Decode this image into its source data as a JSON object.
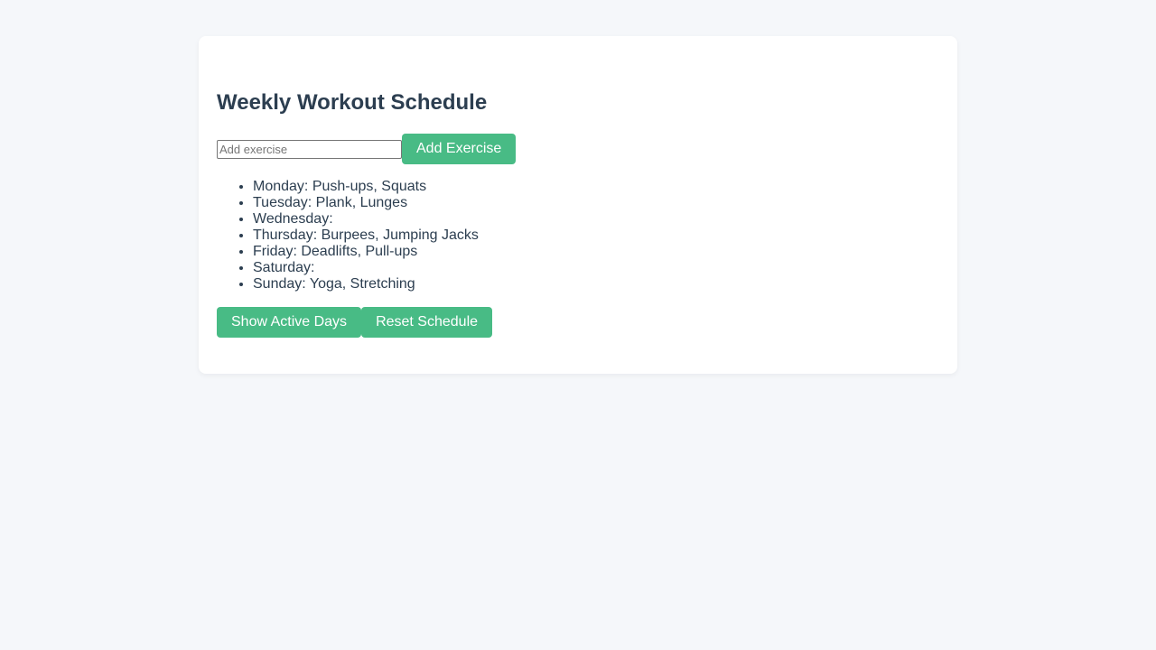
{
  "page": {
    "title": "Weekly Workout Schedule"
  },
  "add_form": {
    "input_value": "",
    "input_placeholder": "Add exercise",
    "add_button_label": "Add Exercise"
  },
  "schedule": [
    {
      "text": "Monday: Push-ups, Squats"
    },
    {
      "text": "Tuesday: Plank, Lunges"
    },
    {
      "text": "Wednesday:"
    },
    {
      "text": "Thursday: Burpees, Jumping Jacks"
    },
    {
      "text": "Friday: Deadlifts, Pull-ups"
    },
    {
      "text": "Saturday:"
    },
    {
      "text": "Sunday: Yoga, Stretching"
    }
  ],
  "actions": {
    "show_active_label": "Show Active Days",
    "reset_label": "Reset Schedule"
  },
  "colors": {
    "background": "#f5f7fa",
    "card": "#ffffff",
    "text": "#2c3e50",
    "accent": "#48bb85"
  }
}
